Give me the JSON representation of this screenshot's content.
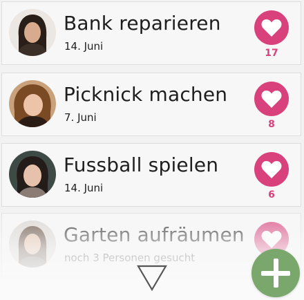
{
  "activities": [
    {
      "title": "Bank reparieren",
      "subtitle": "14. Juni",
      "likes": "17"
    },
    {
      "title": "Picknick machen",
      "subtitle": "7. Juni",
      "likes": "8"
    },
    {
      "title": "Fussball spielen",
      "subtitle": "14. Juni",
      "likes": "6"
    },
    {
      "title": "Garten aufräumen",
      "subtitle": "noch 3  Personen gesucht",
      "likes": ""
    }
  ],
  "colors": {
    "like_accent": "#d8417b",
    "add_button": "#7aa86c",
    "card_background": "#f7f7f7"
  },
  "icons": {
    "like": "heart-icon",
    "more": "triangle-down-icon",
    "add": "plus-icon"
  }
}
